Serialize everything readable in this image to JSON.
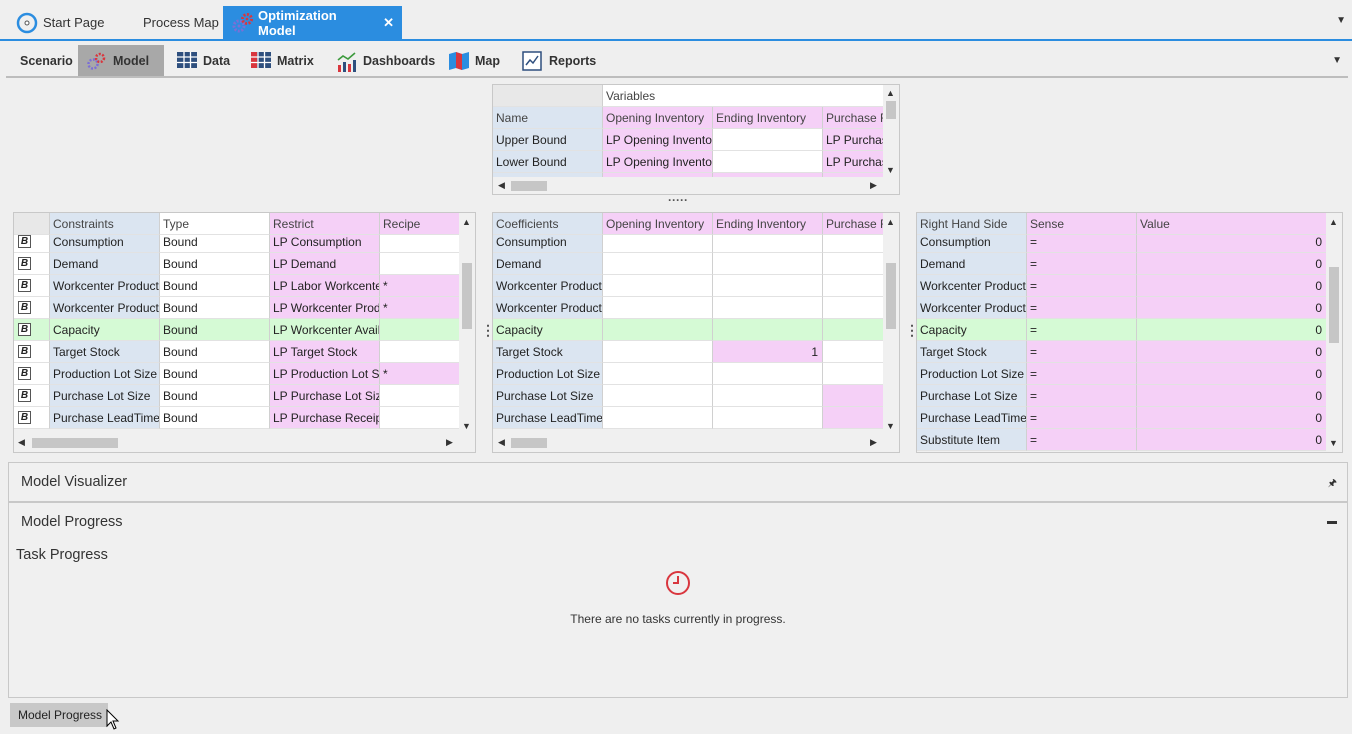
{
  "doc_tabs": [
    {
      "label": "Start Page",
      "icon": "compass-icon"
    },
    {
      "label": "Process Map",
      "icon": ""
    },
    {
      "label": "Optimization Model",
      "icon": "gears-icon",
      "active": true
    }
  ],
  "close_glyph": "✕",
  "ribbon_tabs": [
    {
      "label": "Scenario"
    },
    {
      "label": "Model",
      "active": true
    },
    {
      "label": "Data"
    },
    {
      "label": "Matrix"
    },
    {
      "label": "Dashboards"
    },
    {
      "label": "Map"
    },
    {
      "label": "Reports"
    }
  ],
  "variables_grid": {
    "group_header": "Variables",
    "columns": [
      "Name",
      "Opening Inventory",
      "Ending Inventory",
      "Purchase R"
    ],
    "rows": [
      [
        "Upper Bound",
        "LP Opening Invento",
        "",
        "LP Purchas"
      ],
      [
        "Lower Bound",
        "LP Opening Invento",
        "",
        "LP Purchas"
      ]
    ]
  },
  "splitter_dots": "·····",
  "constraints_grid": {
    "columns": [
      "",
      "Constraints",
      "Type",
      "Restrict",
      "Recipe"
    ],
    "rows": [
      {
        "name": "Consumption",
        "type": "Bound",
        "restrict": "LP Consumption",
        "recipe": ""
      },
      {
        "name": "Demand",
        "type": "Bound",
        "restrict": "LP Demand",
        "recipe": ""
      },
      {
        "name": "Workcenter Product",
        "type": "Bound",
        "restrict": "LP Labor Workcente",
        "recipe": "*"
      },
      {
        "name": "Workcenter Product",
        "type": "Bound",
        "restrict": "LP Workcenter Prod",
        "recipe": "*"
      },
      {
        "name": "Capacity",
        "type": "Bound",
        "restrict": "LP Workcenter Avail",
        "recipe": ""
      },
      {
        "name": "Target Stock",
        "type": "Bound",
        "restrict": "LP Target Stock",
        "recipe": ""
      },
      {
        "name": "Production Lot Size",
        "type": "Bound",
        "restrict": "LP Production Lot S",
        "recipe": "*"
      },
      {
        "name": "Purchase Lot Size",
        "type": "Bound",
        "restrict": "LP Purchase Lot Size",
        "recipe": ""
      },
      {
        "name": "Purchase LeadTime",
        "type": "Bound",
        "restrict": "LP Purchase Receipt",
        "recipe": ""
      }
    ]
  },
  "bound_glyph": "B",
  "coefficients_grid": {
    "columns": [
      "Coefficients",
      "Opening Inventory",
      "Ending Inventory",
      "Purchase R"
    ],
    "rows": [
      {
        "name": "Consumption",
        "opening": "",
        "ending": "",
        "purchase": ""
      },
      {
        "name": "Demand",
        "opening": "",
        "ending": "",
        "purchase": ""
      },
      {
        "name": "Workcenter Product",
        "opening": "",
        "ending": "",
        "purchase": ""
      },
      {
        "name": "Workcenter Product",
        "opening": "",
        "ending": "",
        "purchase": ""
      },
      {
        "name": "Capacity",
        "opening": "",
        "ending": "",
        "purchase": ""
      },
      {
        "name": "Target Stock",
        "opening": "",
        "ending": "1",
        "purchase": ""
      },
      {
        "name": "Production Lot Size",
        "opening": "",
        "ending": "",
        "purchase": ""
      },
      {
        "name": "Purchase Lot Size",
        "opening": "",
        "ending": "",
        "purchase": ""
      },
      {
        "name": "Purchase LeadTime",
        "opening": "",
        "ending": "",
        "purchase": ""
      }
    ]
  },
  "rhs_grid": {
    "columns": [
      "Right Hand Side",
      "Sense",
      "Value"
    ],
    "rows": [
      {
        "name": "Consumption",
        "sense": "=",
        "value": "0"
      },
      {
        "name": "Demand",
        "sense": "=",
        "value": "0"
      },
      {
        "name": "Workcenter Product",
        "sense": "=",
        "value": "0"
      },
      {
        "name": "Workcenter Product",
        "sense": "=",
        "value": "0"
      },
      {
        "name": "Capacity",
        "sense": "=",
        "value": "0"
      },
      {
        "name": "Target Stock",
        "sense": "=",
        "value": "0"
      },
      {
        "name": "Production Lot Size",
        "sense": "=",
        "value": "0"
      },
      {
        "name": "Purchase Lot Size",
        "sense": "=",
        "value": "0"
      },
      {
        "name": "Purchase LeadTime",
        "sense": "=",
        "value": "0"
      },
      {
        "name": "Substitute Item",
        "sense": "=",
        "value": "0"
      }
    ]
  },
  "model_visualizer": {
    "title": "Model Visualizer"
  },
  "model_progress": {
    "title": "Model Progress",
    "task_progress_label": "Task Progress",
    "empty_message": "There are no tasks currently in progress."
  },
  "bottom_tab": {
    "label": "Model Progress"
  },
  "colors": {
    "accent": "#2b8de0",
    "blue_cell": "#dbe5f1",
    "pink_cell": "#f5d0f7",
    "green_row": "#d5fad5",
    "clock": "#d9363e"
  }
}
